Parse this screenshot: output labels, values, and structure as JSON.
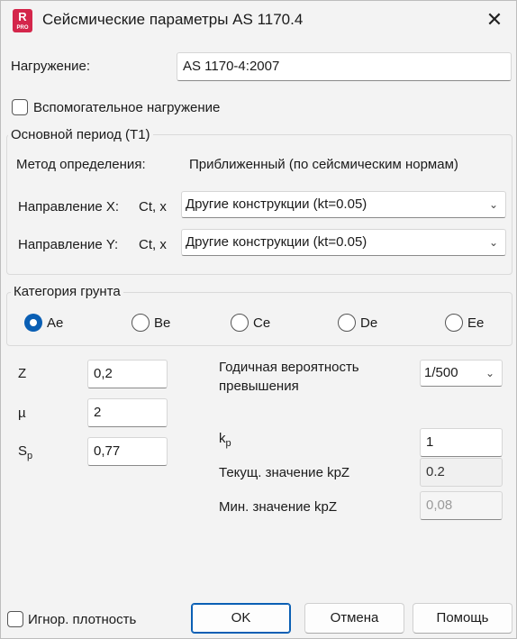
{
  "window": {
    "title": "Сейсмические параметры AS 1170.4",
    "app_icon_letter": "R",
    "app_icon_sub": "PRO",
    "close_symbol": "✕"
  },
  "load": {
    "label": "Нагружение:",
    "value": "AS 1170-4:2007"
  },
  "auxiliary": {
    "label": "Вспомогательное нагружение",
    "checked": false
  },
  "period": {
    "legend": "Основной период (T1)",
    "method_label": "Метод определения:",
    "method_value": "Приближенный (по сейсмическим нормам)",
    "dir_x_label": "Направление X:",
    "ct_x_label": "Ct, x",
    "dir_x_value": "Другие конструкции (kt=0.05)",
    "dir_y_label": "Направление Y:",
    "ct_y_label": "Ct, x",
    "dir_y_value": "Другие конструкции (kt=0.05)"
  },
  "soil": {
    "legend": "Категория грунта",
    "options": [
      "Ae",
      "Be",
      "Ce",
      "De",
      "Ee"
    ],
    "selected": "Ae"
  },
  "params": {
    "z_label": "Z",
    "z_value": "0,2",
    "mu_label": "µ",
    "mu_value": "2",
    "sp_label_main": "S",
    "sp_label_sub": "p",
    "sp_value": "0,77",
    "prob_label_1": "Годичная вероятность",
    "prob_label_2": "превышения",
    "prob_value": "1/500",
    "kp_label_main": "k",
    "kp_label_sub": "p",
    "kp_value": "1",
    "kpz_current_label": "Текущ. значение kpZ",
    "kpz_current_value": "0.2",
    "kpz_min_label": "Мин. значение kpZ",
    "kpz_min_value": "0,08"
  },
  "footer": {
    "ignore_density_label": "Игнор. плотность",
    "ignore_density_checked": false,
    "ok_label": "OK",
    "cancel_label": "Отмена",
    "help_label": "Помощь"
  },
  "icons": {
    "chevron": "chevron-down-icon",
    "close": "close-icon"
  }
}
